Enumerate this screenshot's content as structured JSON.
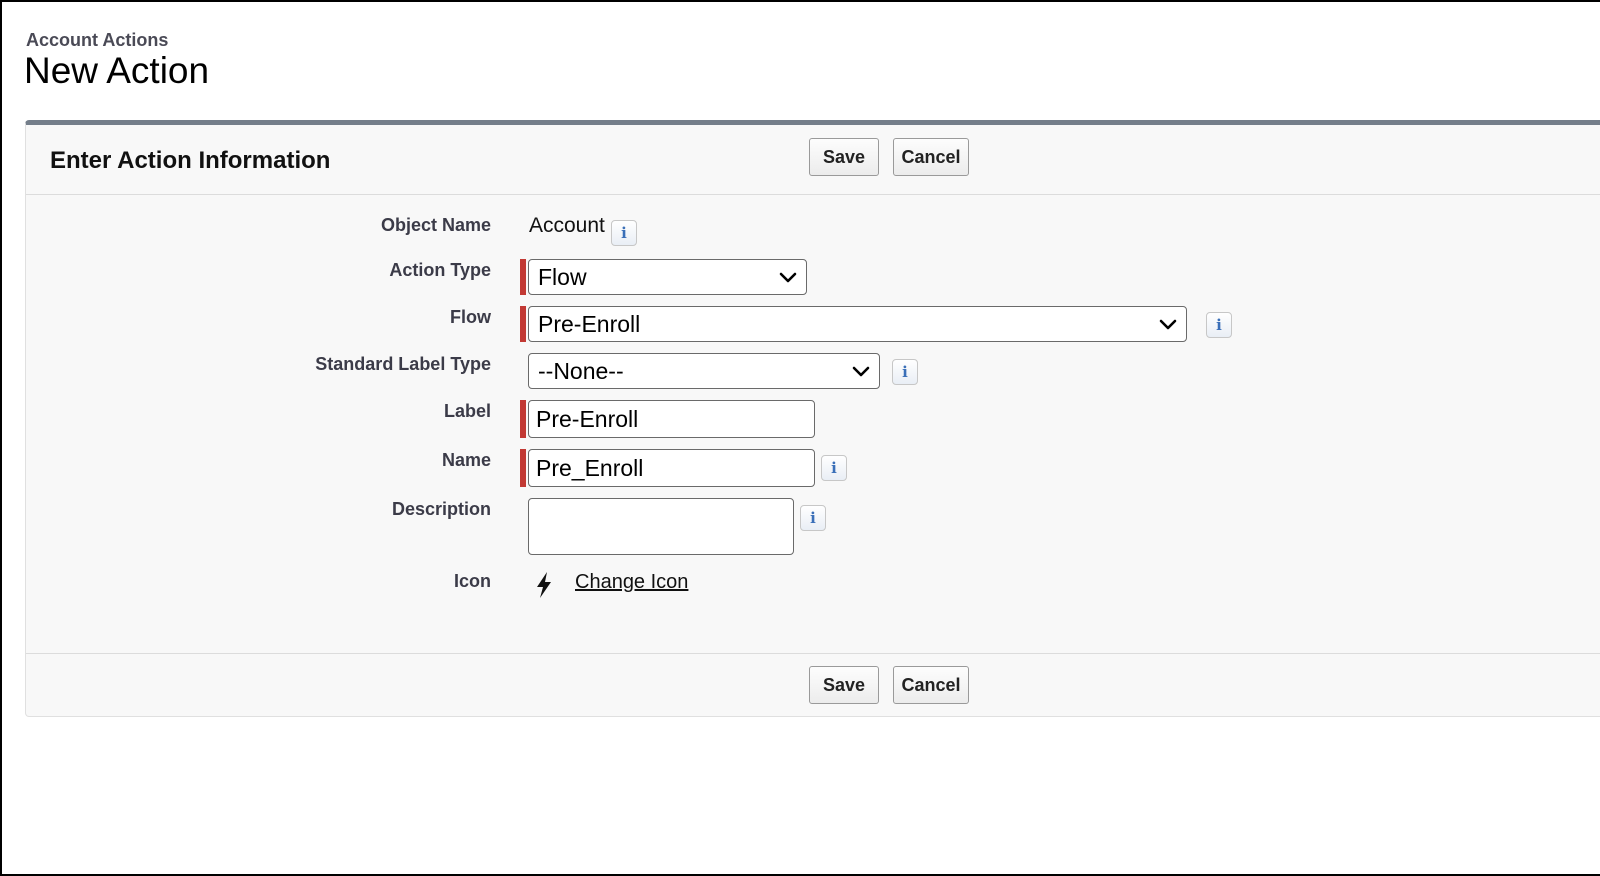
{
  "breadcrumb": "Account Actions",
  "page_title": "New Action",
  "section": {
    "title": "Enter Action Information",
    "save_label": "Save",
    "cancel_label": "Cancel"
  },
  "fields": {
    "object_name": {
      "label": "Object Name",
      "value": "Account"
    },
    "action_type": {
      "label": "Action Type",
      "value": "Flow",
      "required": true
    },
    "flow": {
      "label": "Flow",
      "value": "Pre-Enroll",
      "required": true
    },
    "standard_label_type": {
      "label": "Standard Label Type",
      "value": "--None--"
    },
    "label": {
      "label": "Label",
      "value": "Pre-Enroll",
      "required": true
    },
    "name": {
      "label": "Name",
      "value": "Pre_Enroll",
      "required": true
    },
    "description": {
      "label": "Description",
      "value": ""
    },
    "icon": {
      "label": "Icon",
      "link": "Change Icon",
      "icon_name": "lightning-bolt-icon"
    }
  },
  "info_icon_glyph": "i",
  "colors": {
    "required_bar": "#c23934",
    "panel_top_border": "#747e8a",
    "info_icon": "#3a6fb8"
  }
}
